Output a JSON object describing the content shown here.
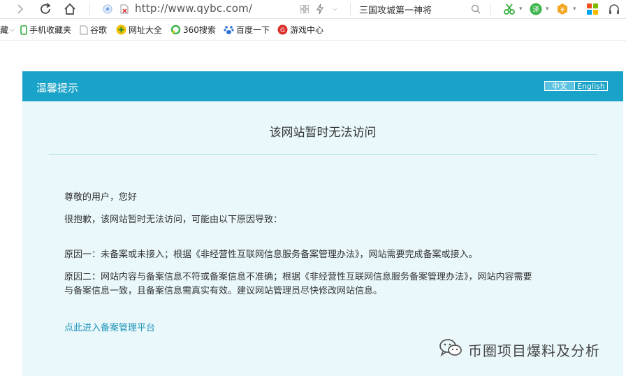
{
  "browser": {
    "url": "http://www.qybc.com/",
    "search_text": "三国攻城第一神将"
  },
  "bookmarks": {
    "items": [
      {
        "label": "手机收藏夹",
        "icon": "phone-icon"
      },
      {
        "label": "谷歌",
        "icon": "page-icon"
      },
      {
        "label": "网址大全",
        "icon": "plus-circle-icon"
      },
      {
        "label": "360搜索",
        "icon": "search-ring-icon"
      },
      {
        "label": "百度一下",
        "icon": "paw-icon"
      },
      {
        "label": "游戏中心",
        "icon": "game-icon"
      }
    ]
  },
  "notice": {
    "header_title": "温馨提示",
    "lang_zh": "中文",
    "lang_en": "English",
    "main_title": "该网站暂时无法访问",
    "greeting": "尊敬的用户，您好",
    "apology": "很抱歉，该网站暂时无法访问，可能由以下原因导致：",
    "reason1": "原因一：未备案或未接入；根据《非经营性互联网信息服务备案管理办法》，网站需要完成备案或接入。",
    "reason2_line1": "原因二：网站内容与备案信息不符或备案信息不准确；根据《非经营性互联网信息服务备案管理办法》，网站内容需要",
    "reason2_line2": "与备案信息一致，且备案信息需真实有效。建议网站管理员尽快修改网站信息。",
    "link": "点此进入备案管理平台"
  },
  "watermark": {
    "text": "币圈项目爆料及分析"
  },
  "colors": {
    "header": "#1aa3c9",
    "panel_bg": "#eaf8fb",
    "link": "#1d93b8"
  }
}
